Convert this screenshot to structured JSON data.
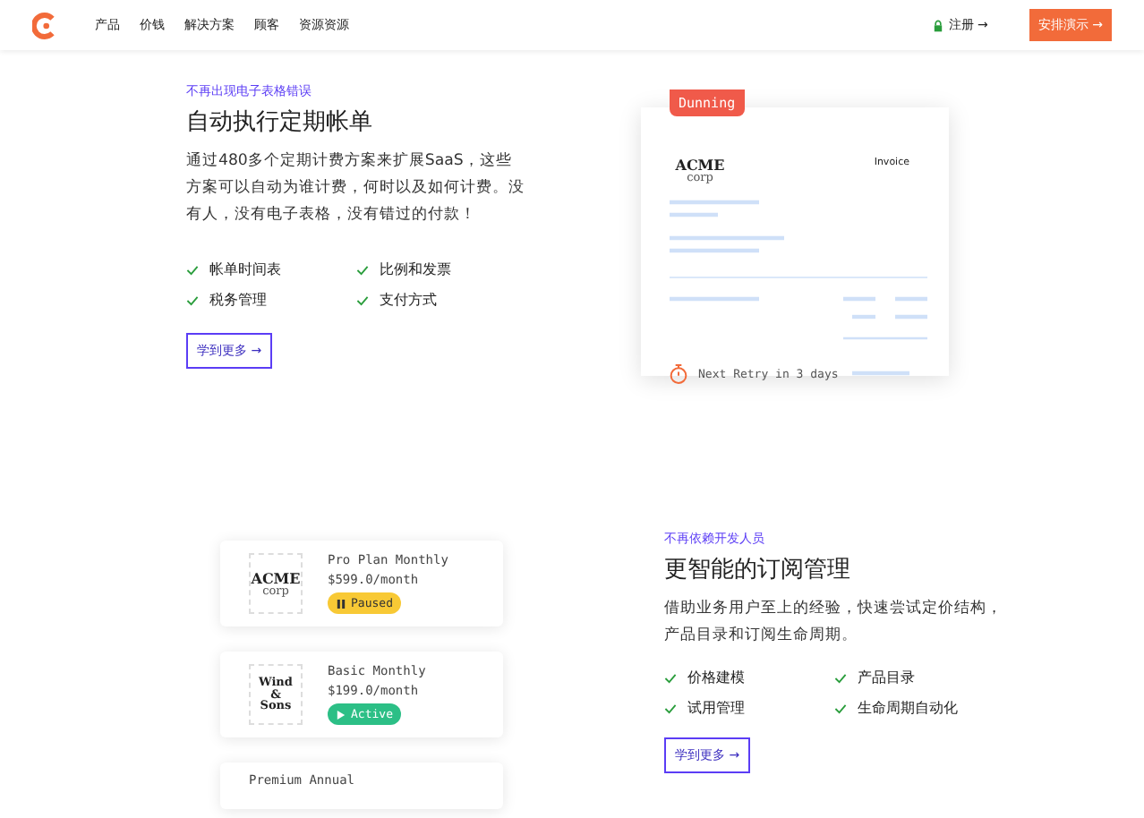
{
  "nav": {
    "items": [
      "产品",
      "价钱",
      "解决方案",
      "顾客",
      "资源资源"
    ],
    "signup": "注册 →",
    "demo": "安排演示 →"
  },
  "section1": {
    "eyebrow": "不再出现电子表格错误",
    "title": "自动执行定期帐单",
    "body": "通过480多个定期计费方案来扩展SaaS，这些方案可以自动为谁计费，何时以及如何计费。没有人，没有电子表格，没有错过的付款！",
    "features": [
      "帐单时间表",
      "比例和发票",
      "税务管理",
      "支付方式"
    ],
    "button": "学到更多 →"
  },
  "invoice": {
    "badge": "Dunning",
    "logo": [
      "ACME",
      "corp"
    ],
    "label": "Invoice",
    "retry": "Next Retry in 3 days"
  },
  "section2": {
    "eyebrow": "不再依赖开发人员",
    "title": "更智能的订阅管理",
    "body": "借助业务用户至上的经验，快速尝试定价结构，产品目录和订阅生命周期。",
    "features": [
      "价格建模",
      "产品目录",
      "试用管理",
      "生命周期自动化"
    ],
    "button": "学到更多 →"
  },
  "plans": [
    {
      "logo": [
        "ACME",
        "corp"
      ],
      "name": "Pro Plan Monthly",
      "price": "$599.0/month",
      "status": {
        "kind": "paused",
        "label": "Paused"
      }
    },
    {
      "logo": [
        "Wind",
        "&",
        "Sons"
      ],
      "name": "Basic Monthly",
      "price": "$199.0/month",
      "status": {
        "kind": "active",
        "label": "Active"
      }
    },
    {
      "name": "Premium Annual"
    }
  ]
}
